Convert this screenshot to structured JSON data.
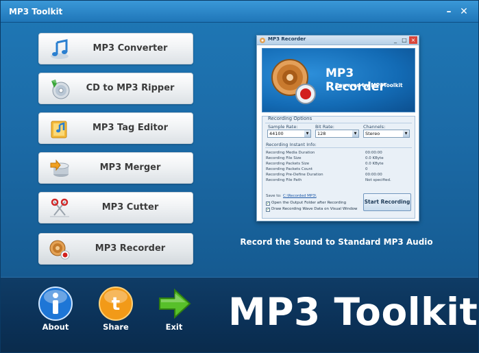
{
  "window": {
    "title": "MP3 Toolkit",
    "minimize_glyph": "–",
    "close_glyph": "✕"
  },
  "menu": {
    "items": [
      {
        "label": "MP3 Converter",
        "icon": "music-note-icon"
      },
      {
        "label": "CD to MP3 Ripper",
        "icon": "cd-disc-icon"
      },
      {
        "label": "MP3 Tag Editor",
        "icon": "tag-editor-icon"
      },
      {
        "label": "MP3 Merger",
        "icon": "merge-disc-icon"
      },
      {
        "label": "MP3 Cutter",
        "icon": "scissors-icon"
      },
      {
        "label": "MP3 Recorder",
        "icon": "speaker-record-icon"
      }
    ],
    "selected": "MP3 Recorder"
  },
  "preview": {
    "window_title": "MP3 Recorder",
    "banner_title": "MP3 Recorder",
    "banner_subtitle": "Powered by MP3Toolkit",
    "group_title": "Recording Options",
    "sample_rate_label": "Sample Rate:",
    "sample_rate_value": "44100",
    "bit_rate_label": "Bit Rate:",
    "bit_rate_value": "128",
    "channels_label": "Channels:",
    "channels_value": "Stereo",
    "instant_info_label": "Recording Instant Info:",
    "info_rows": [
      {
        "label": "Recording Media Duration",
        "value": "00:00:00"
      },
      {
        "label": "Recording File Size",
        "value": "0.0 KByte"
      },
      {
        "label": "Recording Packets Size",
        "value": "0.0 KByte"
      },
      {
        "label": "Recording Packets Count",
        "value": "0"
      },
      {
        "label": "Recording Pre-Define Duration",
        "value": "00:00:00"
      },
      {
        "label": "Recording File Path",
        "value": "Not specified."
      }
    ],
    "save_to_label": "Save to:",
    "save_to_path": "C:\\Recorded MP3\\",
    "checkbox_open_folder": "Open the Output Folder after Recording",
    "checkbox_draw_wave": "Draw Recording Wave Data on Visual Window",
    "start_button": "Start Recording"
  },
  "caption": "Record the Sound to Standard MP3 Audio",
  "bottom": {
    "about_label": "About",
    "share_label": "Share",
    "exit_label": "Exit",
    "brand": "MP3 Toolkit"
  },
  "colors": {
    "accent": "#1f78b6",
    "bottom_bar": "#0b3157",
    "button_text": "#3b3b3b"
  }
}
